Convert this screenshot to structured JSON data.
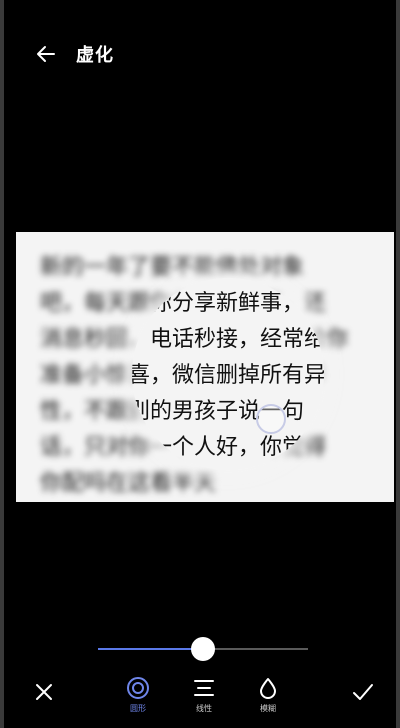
{
  "header": {
    "title": "虚化",
    "back_icon": "arrow-left-icon"
  },
  "photo": {
    "lines": [
      "新的一年了要不能佛处对象",
      "吧，每天跟你分享新鲜事，还",
      "消息秒回，电话秒接，经常给你",
      "准备小惊喜，微信删掉所有异",
      "性，不跟别的男孩子说一句",
      "话，只对你一个人好，你觉得",
      "你配吗在这看半天"
    ]
  },
  "slider": {
    "value": 0.5,
    "accent": "#5b79e8"
  },
  "toolbar": {
    "cancel_icon": "close-icon",
    "confirm_icon": "check-icon",
    "modes": [
      {
        "label": "圆形",
        "icon": "circle-mode-icon",
        "active": true
      },
      {
        "label": "线性",
        "icon": "linear-mode-icon",
        "active": false
      },
      {
        "label": "模糊",
        "icon": "drop-icon",
        "active": false
      }
    ]
  }
}
